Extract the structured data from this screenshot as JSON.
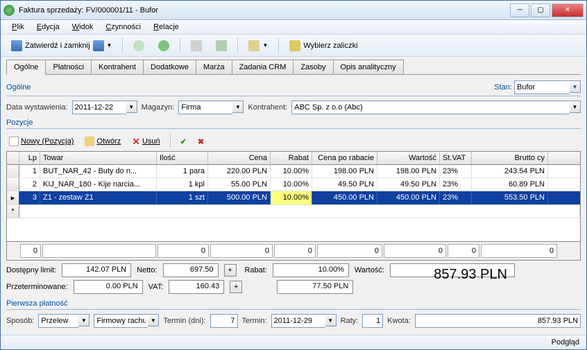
{
  "window": {
    "title": "Faktura sprzedaży: FV/000001/11 - Bufor"
  },
  "menu": {
    "plik": "Plik",
    "edycja": "Edycja",
    "widok": "Widok",
    "czynnosci": "Czynności",
    "relacje": "Relacje"
  },
  "toolbar": {
    "zatwierdz": "Zatwierdź i zamknij",
    "wybierz": "Wybierz zaliczki"
  },
  "tabs": [
    "Ogólne",
    "Płatności",
    "Kontrahent",
    "Dodatkowe",
    "Marża",
    "Zadania CRM",
    "Zasoby",
    "Opis analityczny"
  ],
  "sections": {
    "ogolne": "Ogólne",
    "pozycje": "Pozycje",
    "platnosc": "Pierwsza płatność"
  },
  "labels": {
    "stan": "Stan:",
    "data": "Data wystawienia:",
    "magazyn": "Magazyn:",
    "kontrahent": "Kontrahent:",
    "dostepny": "Dostępny limit:",
    "netto": "Netto:",
    "rabat": "Rabat:",
    "przeterminowane": "Przeterminowane:",
    "vat": "VAT:",
    "wartosc": "Wartość:",
    "sposob": "Sposób:",
    "termin_dni": "Termin (dni):",
    "termin": "Termin:",
    "raty": "Raty:",
    "kwota": "Kwota:"
  },
  "values": {
    "stan": "Bufor",
    "data": "2011-12-22",
    "magazyn": "Firma",
    "kontrahent": "ABC Sp. z o.o (Abc)",
    "dostepny": "142.07 PLN",
    "przeterminowane": "0.00 PLN",
    "netto": "697.50",
    "vat": "160.43",
    "rabat_pct": "10.00%",
    "rabat_val": "77.50 PLN",
    "wartosc": "857.93 PLN",
    "sposob": "Przelew",
    "rachunek": "Firmowy rachu",
    "termin_dni": "7",
    "termin": "2011-12-29",
    "raty": "1",
    "kwota": "857.93 PLN"
  },
  "posbar": {
    "nowy": "Nowy (Pozycja)",
    "otworz": "Otwórz",
    "usun": "Usuń"
  },
  "grid": {
    "headers": {
      "lp": "Lp",
      "towar": "Towar",
      "ilosc": "Ilość",
      "cena": "Cena",
      "rabat": "Rabat",
      "cpr": "Cena po rabacie",
      "wart": "Wartość",
      "vat": "St.VAT",
      "brutto": "Brutto cy"
    },
    "rows": [
      {
        "lp": "1",
        "towar": "BUT_NAR_42 - Buty do n...",
        "ilosc": "1 para",
        "cena": "220.00 PLN",
        "rabat": "10.00%",
        "cpr": "198.00 PLN",
        "wart": "198.00 PLN",
        "vat": "23%",
        "brutto": "243.54 PLN"
      },
      {
        "lp": "2",
        "towar": "KIJ_NAR_180 - Kije narcia...",
        "ilosc": "1 kpl",
        "cena": "55.00 PLN",
        "rabat": "10.00%",
        "cpr": "49.50 PLN",
        "wart": "49.50 PLN",
        "vat": "23%",
        "brutto": "60.89 PLN"
      },
      {
        "lp": "3",
        "towar": "Z1 - zestaw Z1",
        "ilosc": "1 szt",
        "cena": "500.00 PLN",
        "rabat": "10.00%",
        "cpr": "450.00 PLN",
        "wart": "450.00 PLN",
        "vat": "23%",
        "brutto": "553.50 PLN"
      }
    ],
    "footer": [
      "0",
      "0",
      "0",
      "0",
      "0",
      "0",
      "0",
      "0"
    ]
  },
  "footer": {
    "podglad": "Podgląd"
  }
}
